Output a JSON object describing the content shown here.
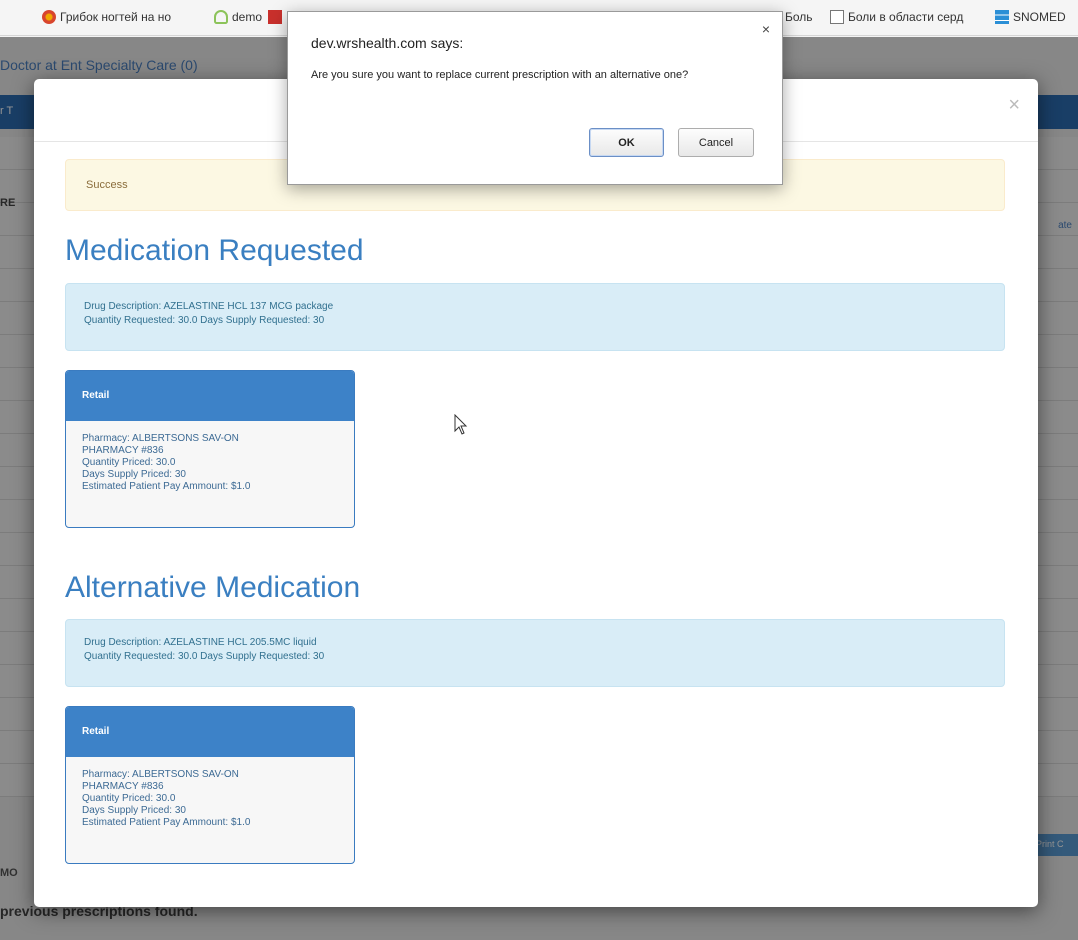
{
  "bookmarks": {
    "items": [
      {
        "label": "Грибок ногтей на но",
        "icon": "flower-icon"
      },
      {
        "label": "demo",
        "icon": "cloud-icon"
      },
      {
        "label": "Боль",
        "icon": "document-icon"
      },
      {
        "label": "Боли в области серд",
        "icon": "document-icon"
      },
      {
        "label": "SNOMED",
        "icon": "snomed-icon"
      }
    ]
  },
  "background": {
    "title": "Doctor at Ent Specialty Care (0)",
    "tab_fragment": "r T",
    "row_fragment": "RE",
    "date_fragment": "ate",
    "print_fragment": "Print C",
    "mo_fragment": "MO",
    "previous_text": "previous prescriptions found."
  },
  "modal": {
    "alert_text": "Success",
    "requested": {
      "title": "Medication Requested",
      "drug_description": "Drug Description: AZELASTINE HCL 137 MCG package",
      "quantity_line": "Quantity Requested: 30.0    Days Supply Requested: 30",
      "panel": {
        "heading": "Retail",
        "pharmacy": "Pharmacy: ALBERTSONS SAV-ON",
        "pharmacy_number": "PHARMACY #836",
        "quantity_priced": "Quantity Priced: 30.0",
        "days_supply": "Days Supply Priced: 30",
        "estimated_pay": "Estimated Patient Pay Ammount: $1.0"
      }
    },
    "alternative": {
      "title": "Alternative Medication",
      "drug_description": "Drug Description: AZELASTINE HCL 205.5MC liquid",
      "quantity_line": "Quantity Requested: 30.0    Days Supply Requested: 30",
      "panel": {
        "heading": "Retail",
        "pharmacy": "Pharmacy: ALBERTSONS SAV-ON",
        "pharmacy_number": "PHARMACY #836",
        "quantity_priced": "Quantity Priced: 30.0",
        "days_supply": "Days Supply Priced: 30",
        "estimated_pay": "Estimated Patient Pay Ammount: $1.0"
      }
    },
    "close_symbol": "×"
  },
  "dialog": {
    "title": "dev.wrshealth.com says:",
    "message": "Are you sure you want to replace current prescription with an alternative one?",
    "ok_label": "OK",
    "cancel_label": "Cancel",
    "close_symbol": "×"
  },
  "colors": {
    "accent_blue": "#3d82c8",
    "title_blue": "#3a7fc1",
    "success_bg": "#fcf8e3",
    "info_bg": "#d9edf7"
  }
}
